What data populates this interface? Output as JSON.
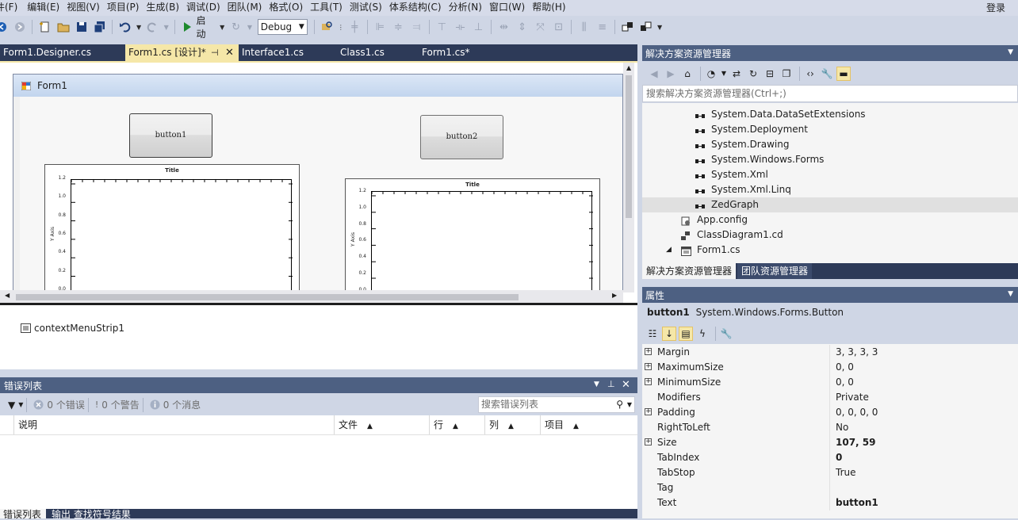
{
  "menu": [
    "件(F)",
    "编辑(E)",
    "视图(V)",
    "项目(P)",
    "生成(B)",
    "调试(D)",
    "团队(M)",
    "格式(O)",
    "工具(T)",
    "测试(S)",
    "体系结构(C)",
    "分析(N)",
    "窗口(W)",
    "帮助(H)"
  ],
  "login": "登录",
  "toolbar": {
    "start_label": "启动",
    "config": "Debug"
  },
  "doc_tabs": [
    {
      "label": "Form1.Designer.cs",
      "active": false
    },
    {
      "label": "Form1.cs [设计]*",
      "active": true
    },
    {
      "label": "Interface1.cs",
      "active": false
    },
    {
      "label": "Class1.cs",
      "active": false
    },
    {
      "label": "Form1.cs*",
      "active": false
    }
  ],
  "designer": {
    "form_title": "Form1",
    "button1": "button1",
    "button2": "button2",
    "graph1": {
      "title": "Title",
      "ylabel": "Y Axis",
      "yticks": [
        "1.2",
        "1.0",
        "0.8",
        "0.6",
        "0.4",
        "0.2",
        "0.0"
      ]
    },
    "graph2": {
      "title": "Title",
      "ylabel": "Y Axis",
      "yticks": [
        "1.2",
        "1.0",
        "0.8",
        "0.6",
        "0.4",
        "0.2",
        "0.0"
      ]
    },
    "tray_item": "contextMenuStrip1"
  },
  "error_list": {
    "title": "错误列表",
    "errors": "0 个错误",
    "warnings": "0 个警告",
    "messages": "0 个消息",
    "search_placeholder": "搜索错误列表",
    "columns": [
      "说明",
      "文件",
      "行",
      "列",
      "项目"
    ]
  },
  "bottom_tabs": [
    "错误列表",
    "输出 查找符号结果"
  ],
  "solution_explorer": {
    "title": "解决方案资源管理器",
    "search_placeholder": "搜索解决方案资源管理器(Ctrl+;)",
    "nodes": [
      {
        "label": "System.Data.DataSetExtensions",
        "kind": "reference",
        "indent": 2
      },
      {
        "label": "System.Deployment",
        "kind": "reference",
        "indent": 2
      },
      {
        "label": "System.Drawing",
        "kind": "reference",
        "indent": 2
      },
      {
        "label": "System.Windows.Forms",
        "kind": "reference",
        "indent": 2
      },
      {
        "label": "System.Xml",
        "kind": "reference",
        "indent": 2
      },
      {
        "label": "System.Xml.Linq",
        "kind": "reference",
        "indent": 2
      },
      {
        "label": "ZedGraph",
        "kind": "reference",
        "indent": 2,
        "selected": true
      },
      {
        "label": "App.config",
        "kind": "config",
        "indent": 1
      },
      {
        "label": "ClassDiagram1.cd",
        "kind": "diagram",
        "indent": 1
      },
      {
        "label": "Form1.cs",
        "kind": "form",
        "indent": 1,
        "expanded": true
      }
    ],
    "tabs": [
      "解决方案资源管理器",
      "团队资源管理器"
    ]
  },
  "properties": {
    "title": "属性",
    "object_name": "button1",
    "object_type": "System.Windows.Forms.Button",
    "rows": [
      {
        "name": "Margin",
        "value": "3, 3, 3, 3",
        "expandable": true,
        "bold": false
      },
      {
        "name": "MaximumSize",
        "value": "0, 0",
        "expandable": true,
        "bold": false
      },
      {
        "name": "MinimumSize",
        "value": "0, 0",
        "expandable": true,
        "bold": false
      },
      {
        "name": "Modifiers",
        "value": "Private",
        "expandable": false,
        "bold": false
      },
      {
        "name": "Padding",
        "value": "0, 0, 0, 0",
        "expandable": true,
        "bold": false
      },
      {
        "name": "RightToLeft",
        "value": "No",
        "expandable": false,
        "bold": false
      },
      {
        "name": "Size",
        "value": "107, 59",
        "expandable": true,
        "bold": true
      },
      {
        "name": "TabIndex",
        "value": "0",
        "expandable": false,
        "bold": true
      },
      {
        "name": "TabStop",
        "value": "True",
        "expandable": false,
        "bold": false
      },
      {
        "name": "Tag",
        "value": "",
        "expandable": false,
        "bold": false
      },
      {
        "name": "Text",
        "value": "button1",
        "expandable": false,
        "bold": true
      }
    ]
  },
  "colors": {
    "accent": "#f5e7a8",
    "panel_title": "#4d6082",
    "tab_strip": "#2d3a58",
    "chrome": "#cfd6e5"
  }
}
